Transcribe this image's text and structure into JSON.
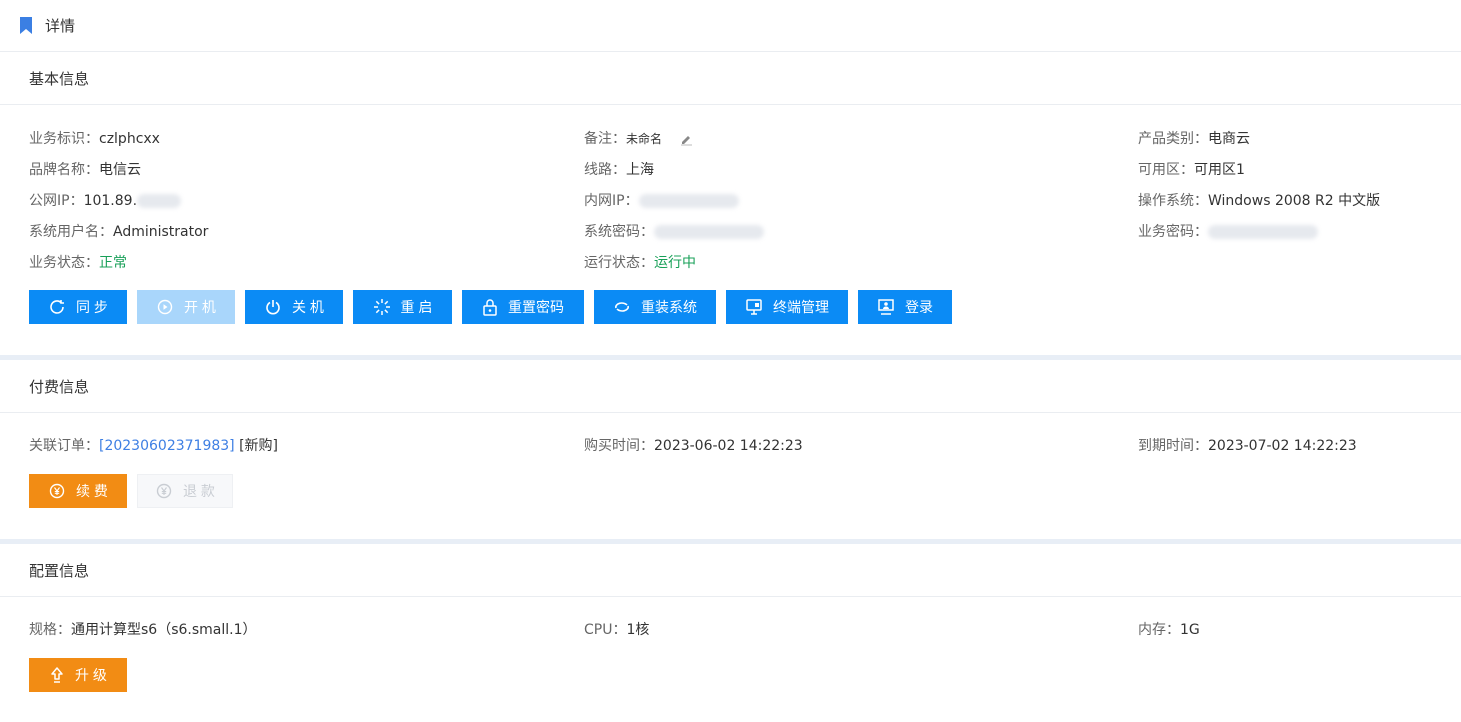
{
  "header": {
    "title": "详情",
    "flag_color": "#3b7fe3",
    "flag_icon": "bookmark-icon"
  },
  "basic": {
    "title": "基本信息",
    "fields": {
      "business_id": {
        "label": "业务标识：",
        "value": "czlphcxx"
      },
      "remark": {
        "label": "备注：",
        "value": "未命名"
      },
      "product_type": {
        "label": "产品类别：",
        "value": "电商云"
      },
      "brand": {
        "label": "品牌名称：",
        "value": "电信云"
      },
      "line": {
        "label": "线路：",
        "value": "上海"
      },
      "zone": {
        "label": "可用区：",
        "value": "可用区1"
      },
      "public_ip": {
        "label": "公网IP：",
        "value": "101.89."
      },
      "private_ip": {
        "label": "内网IP：",
        "value": ""
      },
      "os": {
        "label": "操作系统：",
        "value": "Windows 2008 R2 中文版"
      },
      "sys_user": {
        "label": "系统用户名：",
        "value": "Administrator"
      },
      "sys_password": {
        "label": "系统密码：",
        "value": ""
      },
      "biz_password": {
        "label": "业务密码：",
        "value": ""
      },
      "biz_status": {
        "label": "业务状态：",
        "value": "正常"
      },
      "run_status": {
        "label": "运行状态：",
        "value": "运行中"
      }
    },
    "buttons": {
      "sync": "同 步",
      "power_on": "开 机",
      "power_off": "关 机",
      "restart": "重 启",
      "reset_password": "重置密码",
      "reinstall": "重装系统",
      "terminal": "终端管理",
      "login": "登录"
    }
  },
  "payment": {
    "title": "付费信息",
    "order_label": "关联订单：",
    "order_link": "[20230602371983]",
    "order_type": "[新购]",
    "buy_time_label": "购买时间：",
    "buy_time": "2023-06-02 14:22:23",
    "expire_label": "到期时间：",
    "expire_time": "2023-07-02 14:22:23",
    "renew": "续 费",
    "refund": "退 款"
  },
  "config": {
    "title": "配置信息",
    "spec_label": "规格：",
    "spec": "通用计算型s6（s6.small.1）",
    "cpu_label": "CPU：",
    "cpu": "1核",
    "mem_label": "内存：",
    "mem": "1G",
    "upgrade": "升 级"
  },
  "colors": {
    "primary": "#0b8bf5",
    "orange": "#f28c14",
    "success": "#18a058",
    "link": "#3e7fe3"
  }
}
